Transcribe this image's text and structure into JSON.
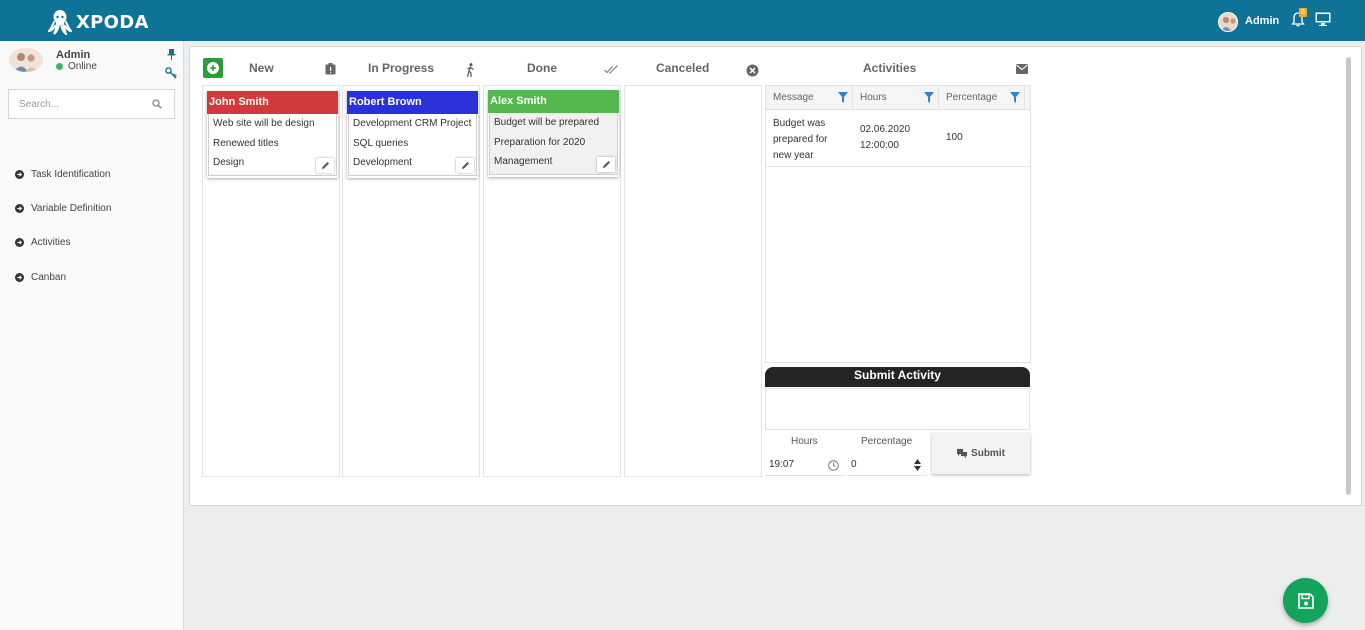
{
  "app": {
    "name": "XPODA"
  },
  "topbar": {
    "user_name": "Admin",
    "notification_count": "8"
  },
  "sidebar": {
    "user_name": "Admin",
    "status": "Online",
    "search_placeholder": "Search...",
    "items": [
      {
        "label": "Task Identification"
      },
      {
        "label": "Variable Definition"
      },
      {
        "label": "Activities"
      },
      {
        "label": "Canban"
      }
    ]
  },
  "board": {
    "columns": [
      {
        "title": "New",
        "icon": "clipboard-alert-icon"
      },
      {
        "title": "In Progress",
        "icon": "walking-person-icon"
      },
      {
        "title": "Done",
        "icon": "double-check-icon"
      },
      {
        "title": "Canceled",
        "icon": "close-circle-icon"
      }
    ],
    "cards": [
      {
        "column": "New",
        "owner": "John Smith",
        "color": "#d03a3a",
        "lines": [
          "Web site will be design",
          "Renewed titles",
          "Design"
        ]
      },
      {
        "column": "In Progress",
        "owner": "Robert Brown",
        "color": "#2832d8",
        "lines": [
          "Development CRM Project",
          "SQL queries",
          "Development"
        ]
      },
      {
        "column": "Done",
        "owner": "Alex Smith",
        "color": "#55b84f",
        "lines": [
          "Budget will be prepared",
          "Preparation for 2020",
          "Management"
        ]
      }
    ]
  },
  "activities": {
    "title": "Activities",
    "columns": [
      "Message",
      "Hours",
      "Percentage"
    ],
    "rows": [
      {
        "message": "Budget was prepared for new year",
        "hours": "02.06.2020 12:00:00",
        "percentage": "100"
      }
    ]
  },
  "submit": {
    "title": "Submit Activity",
    "hours_label": "Hours",
    "percentage_label": "Percentage",
    "hours_value": "19:07",
    "percentage_value": "0",
    "button_label": "Submit"
  },
  "colors": {
    "topbar": "#0e7396",
    "add_button": "#2a9d3a",
    "save_fab": "#13a35a"
  }
}
